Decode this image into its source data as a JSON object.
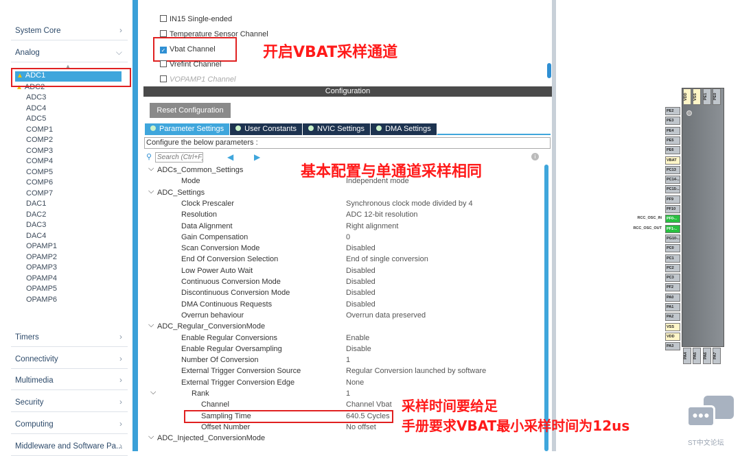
{
  "sidebar": {
    "categories_top": [
      {
        "label": "System Core",
        "chevron": ">"
      },
      {
        "label": "Analog",
        "chevron": "v"
      }
    ],
    "analog_items": [
      "ADC1",
      "ADC2",
      "ADC3",
      "ADC4",
      "ADC5",
      "COMP1",
      "COMP2",
      "COMP3",
      "COMP4",
      "COMP5",
      "COMP6",
      "COMP7",
      "DAC1",
      "DAC2",
      "DAC3",
      "DAC4",
      "OPAMP1",
      "OPAMP2",
      "OPAMP3",
      "OPAMP4",
      "OPAMP5",
      "OPAMP6"
    ],
    "warning_items": [
      "ADC1",
      "ADC2"
    ],
    "selected": "ADC1",
    "categories_bottom": [
      "Timers",
      "Connectivity",
      "Multimedia",
      "Security",
      "Computing",
      "Middleware and Software Pa..."
    ]
  },
  "channels": [
    {
      "label": "IN15 Single-ended",
      "checked": false
    },
    {
      "label": "Temperature Sensor Channel",
      "checked": false
    },
    {
      "label": "Vbat Channel",
      "checked": true
    },
    {
      "label": "Vrefint Channel",
      "checked": false
    },
    {
      "label": "VOPAMP1 Channel",
      "checked": false,
      "disabled": true
    }
  ],
  "config": {
    "header": "Configuration",
    "reset_label": "Reset Configuration",
    "tabs": [
      "Parameter Settings",
      "User Constants",
      "NVIC Settings",
      "DMA Settings"
    ],
    "active_tab": "Parameter Settings",
    "configure_label": "Configure the below parameters :",
    "search_placeholder": "Search (Ctrl+F)",
    "rows": [
      {
        "k": "ADCs_Common_Settings",
        "v": "",
        "lvl": 0,
        "grp": true
      },
      {
        "k": "Mode",
        "v": "Independent mode",
        "lvl": 1
      },
      {
        "k": "ADC_Settings",
        "v": "",
        "lvl": 0,
        "grp": true
      },
      {
        "k": "Clock Prescaler",
        "v": "Synchronous clock mode divided by 4",
        "lvl": 1
      },
      {
        "k": "Resolution",
        "v": "ADC 12-bit resolution",
        "lvl": 1
      },
      {
        "k": "Data Alignment",
        "v": "Right alignment",
        "lvl": 1
      },
      {
        "k": "Gain Compensation",
        "v": "0",
        "lvl": 1
      },
      {
        "k": "Scan Conversion Mode",
        "v": "Disabled",
        "lvl": 1
      },
      {
        "k": "End Of Conversion Selection",
        "v": "End of single conversion",
        "lvl": 1
      },
      {
        "k": "Low Power Auto Wait",
        "v": "Disabled",
        "lvl": 1
      },
      {
        "k": "Continuous Conversion Mode",
        "v": "Disabled",
        "lvl": 1
      },
      {
        "k": "Discontinuous Conversion Mode",
        "v": "Disabled",
        "lvl": 1
      },
      {
        "k": "DMA Continuous Requests",
        "v": "Disabled",
        "lvl": 1
      },
      {
        "k": "Overrun behaviour",
        "v": "Overrun data preserved",
        "lvl": 1
      },
      {
        "k": "ADC_Regular_ConversionMode",
        "v": "",
        "lvl": 0,
        "grp": true
      },
      {
        "k": "Enable Regular Conversions",
        "v": "Enable",
        "lvl": 1
      },
      {
        "k": "Enable Regular Oversampling",
        "v": "Disable",
        "lvl": 1
      },
      {
        "k": "Number Of Conversion",
        "v": "1",
        "lvl": 1
      },
      {
        "k": "External Trigger Conversion Source",
        "v": "Regular Conversion launched by software",
        "lvl": 1
      },
      {
        "k": "External Trigger Conversion Edge",
        "v": "None",
        "lvl": 1
      },
      {
        "k": "Rank",
        "v": "1",
        "lvl": 2,
        "grp": true
      },
      {
        "k": "Channel",
        "v": "Channel Vbat",
        "lvl": 3
      },
      {
        "k": "Sampling Time",
        "v": "640.5 Cycles",
        "lvl": 3
      },
      {
        "k": "Offset Number",
        "v": "No offset",
        "lvl": 3
      },
      {
        "k": "ADC_Injected_ConversionMode",
        "v": "",
        "lvl": 0,
        "grp": true
      }
    ]
  },
  "annotations": {
    "vbat": "开启VBAT采样通道",
    "basic": "基本配置与单通道采样相同",
    "sampling1": "采样时间要给足",
    "sampling2": "手册要求VBAT最小采样时间为12us"
  },
  "chip": {
    "left_pins": [
      {
        "n": "PE2",
        "c": "gray"
      },
      {
        "n": "PE3",
        "c": "gray"
      },
      {
        "n": "PE4",
        "c": "gray"
      },
      {
        "n": "PE5",
        "c": "gray"
      },
      {
        "n": "PE6",
        "c": "gray"
      },
      {
        "n": "VBAT",
        "c": "yellow"
      },
      {
        "n": "PC13",
        "c": "gray"
      },
      {
        "n": "PC14-..",
        "c": "gray"
      },
      {
        "n": "PC15-..",
        "c": "gray"
      },
      {
        "n": "PF9",
        "c": "gray"
      },
      {
        "n": "PF10",
        "c": "gray"
      },
      {
        "n": "PF0-..",
        "c": "green",
        "sig": "RCC_OSC_IN"
      },
      {
        "n": "PF1-..",
        "c": "green",
        "sig": "RCC_OSC_OUT"
      },
      {
        "n": "PG10-..",
        "c": "gray"
      },
      {
        "n": "PC0",
        "c": "gray"
      },
      {
        "n": "PC1",
        "c": "gray"
      },
      {
        "n": "PC2",
        "c": "gray"
      },
      {
        "n": "PC3",
        "c": "gray"
      },
      {
        "n": "PF2",
        "c": "gray"
      },
      {
        "n": "PA0",
        "c": "gray"
      },
      {
        "n": "PA1",
        "c": "gray"
      },
      {
        "n": "PA2",
        "c": "gray"
      },
      {
        "n": "VSS",
        "c": "yellow"
      },
      {
        "n": "VDD",
        "c": "yellow"
      },
      {
        "n": "PA3",
        "c": "gray"
      }
    ],
    "top_pins": [
      {
        "n": "VDD",
        "c": "yellow"
      },
      {
        "n": "VSS",
        "c": "yellow"
      },
      {
        "n": "PE1",
        "c": "gray"
      },
      {
        "n": "PE0",
        "c": "gray"
      }
    ],
    "bottom_pins": [
      {
        "n": "PA4",
        "c": "gray"
      },
      {
        "n": "PA5",
        "c": "gray"
      },
      {
        "n": "PA6",
        "c": "gray"
      },
      {
        "n": "PA7",
        "c": "gray"
      }
    ]
  },
  "watermark": "ST中文论坛",
  "colors": {
    "accent": "#3fa6dc",
    "tab_dark": "#1d3350",
    "annotation": "#ff1a1a",
    "pin_green": "#28c040",
    "pin_yellow": "#fff6c8"
  }
}
